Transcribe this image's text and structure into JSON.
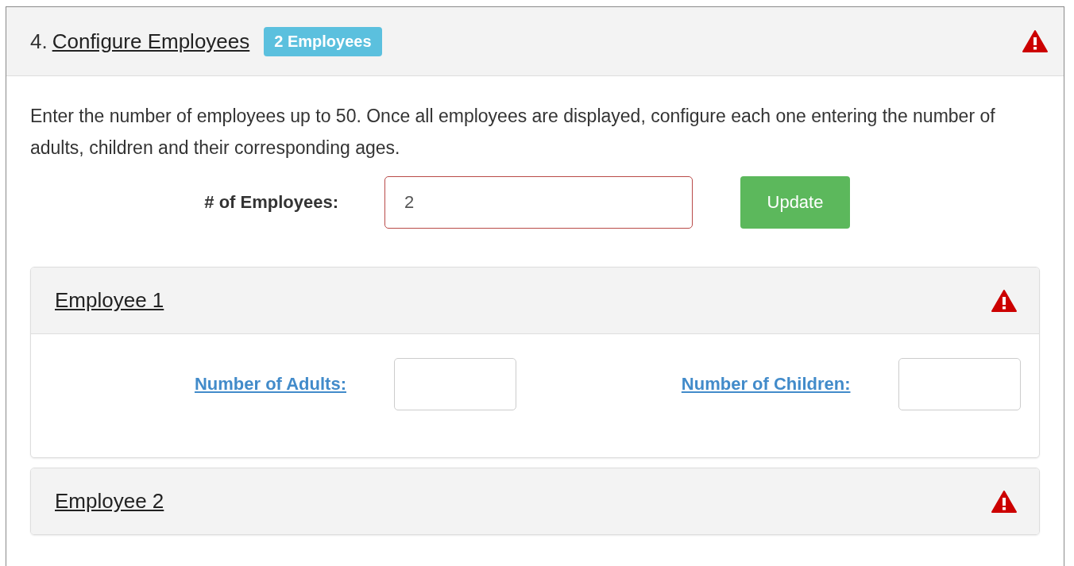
{
  "section": {
    "number": "4.",
    "title": "Configure Employees",
    "badge": "2 Employees",
    "warning": true
  },
  "description": "Enter the number of employees up to 50. Once all employees are displayed, configure each one entering the number of adults, children and their corresponding ages.",
  "employee_count": {
    "label": "# of Employees:",
    "value": "2",
    "invalid": true
  },
  "update_button": "Update",
  "employees": [
    {
      "title": "Employee 1",
      "warning": true,
      "expanded": true,
      "fields": [
        {
          "label": "Number of Adults:"
        },
        {
          "label": "Number of Children:"
        }
      ]
    },
    {
      "title": "Employee 2",
      "warning": true,
      "expanded": false
    }
  ]
}
